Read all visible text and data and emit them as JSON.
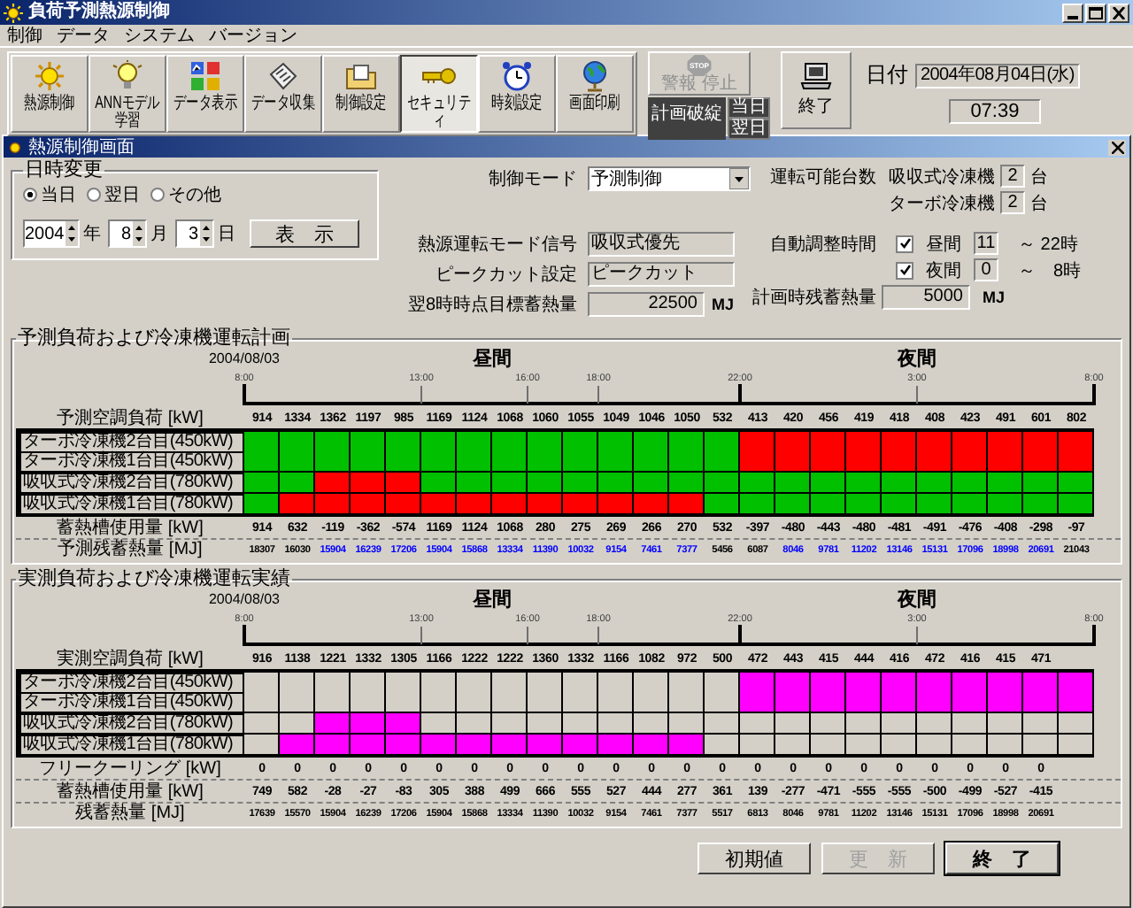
{
  "window": {
    "title": "負荷予測熱源制御"
  },
  "menu": [
    "制御",
    "データ",
    "システム",
    "バージョン"
  ],
  "toolbar": [
    {
      "label": "熱源制御",
      "kind": "sun",
      "selected": false
    },
    {
      "label": "ANNモデル学習",
      "kind": "bulb",
      "selected": false
    },
    {
      "label": "データ表示",
      "kind": "charts",
      "selected": false
    },
    {
      "label": "データ収集",
      "kind": "papers",
      "selected": false
    },
    {
      "label": "制御設定",
      "kind": "folder",
      "selected": false
    },
    {
      "label": "セキュリティ",
      "kind": "key",
      "selected": true
    },
    {
      "label": "時刻設定",
      "kind": "clock",
      "selected": false
    },
    {
      "label": "画面印刷",
      "kind": "globe",
      "selected": false
    }
  ],
  "alarm": {
    "sign": "STOP",
    "label": "警報 停止",
    "disabled": true
  },
  "plan_status": {
    "label": "計画破綻",
    "days": [
      "当日",
      "翌日"
    ]
  },
  "exit_button": "終了",
  "date": {
    "label": "日付",
    "value": "2004年08月04日(水)",
    "time": "07:39"
  },
  "screen": {
    "title": "熱源制御画面",
    "date_change": {
      "title": "日時変更",
      "options": [
        {
          "label": "当日",
          "selected": true
        },
        {
          "label": "翌日",
          "selected": false
        },
        {
          "label": "その他",
          "selected": false
        }
      ],
      "fields": [
        {
          "value": "2004",
          "unit": "年"
        },
        {
          "value": "8",
          "unit": "月"
        },
        {
          "value": "3",
          "unit": "日"
        }
      ],
      "button": "表　示"
    },
    "control_mode": {
      "label": "制御モード",
      "value": "予測制御"
    },
    "settings": [
      {
        "label": "熱源運転モード信号",
        "value": "吸収式優先"
      },
      {
        "label": "ピークカット設定",
        "value": "ピークカット"
      },
      {
        "label": "翌8時時点目標蓄熱量",
        "value": "22500",
        "unit": "MJ"
      }
    ],
    "available": {
      "label": "運転可能台数",
      "items": [
        {
          "name": "吸収式冷凍機",
          "value": "2",
          "unit": "台"
        },
        {
          "name": "ターボ冷凍機",
          "value": "2",
          "unit": "台"
        }
      ]
    },
    "auto_adjust": {
      "label": "自動調整時間",
      "items": [
        {
          "name": "昼間",
          "checked": true,
          "from": "11",
          "to": "～ 22時"
        },
        {
          "name": "夜間",
          "checked": true,
          "from": "0",
          "to": "～　8時"
        }
      ]
    },
    "plan_remaining": {
      "label": "計画時残蓄熱量",
      "value": "5000",
      "unit": "MJ"
    },
    "sections": [
      {
        "kind": "plan",
        "title": "予測負荷および冷凍機運転計画",
        "date": "2004/08/03",
        "periods": [
          "昼間",
          "夜間"
        ],
        "boundaries": [
          {
            "kind": "edge",
            "label": "8:00"
          },
          {
            "kind": "none"
          },
          {
            "kind": "none"
          },
          {
            "kind": "none"
          },
          {
            "kind": "none"
          },
          {
            "kind": "tick",
            "label": "13:00"
          },
          {
            "kind": "none"
          },
          {
            "kind": "none"
          },
          {
            "kind": "tick",
            "label": "16:00"
          },
          {
            "kind": "none"
          },
          {
            "kind": "tick",
            "label": "18:00"
          },
          {
            "kind": "none"
          },
          {
            "kind": "none"
          },
          {
            "kind": "none"
          },
          {
            "kind": "edge",
            "label": "22:00"
          },
          {
            "kind": "none"
          },
          {
            "kind": "none"
          },
          {
            "kind": "none"
          },
          {
            "kind": "none"
          },
          {
            "kind": "tick",
            "label": "3:00"
          },
          {
            "kind": "none"
          },
          {
            "kind": "none"
          },
          {
            "kind": "none"
          },
          {
            "kind": "none"
          },
          {
            "kind": "edge",
            "label": "8:00"
          }
        ],
        "rows": [
          {
            "kind": "load",
            "label": "予測空調負荷 [kW]",
            "values": [
              "914",
              "1334",
              "1362",
              "1197",
              "985",
              "1169",
              "1124",
              "1068",
              "1060",
              "1055",
              "1049",
              "1046",
              "1050",
              "532",
              "413",
              "420",
              "456",
              "419",
              "418",
              "408",
              "423",
              "491",
              "601",
              "802"
            ]
          },
          {
            "kind": "units",
            "label": "ターボ冷凍機2台目(450kW)",
            "cells": [
              false,
              false,
              false,
              false,
              false,
              false,
              false,
              false,
              false,
              false,
              false,
              false,
              false,
              false,
              true,
              true,
              true,
              true,
              true,
              true,
              true,
              true,
              true,
              true
            ]
          },
          {
            "kind": "units",
            "label": "ターボ冷凍機1台目(450kW)",
            "cells": [
              false,
              false,
              false,
              false,
              false,
              false,
              false,
              false,
              false,
              false,
              false,
              false,
              false,
              false,
              true,
              true,
              true,
              true,
              true,
              true,
              true,
              true,
              true,
              true
            ]
          },
          {
            "kind": "units",
            "label": "吸収式冷凍機2台目(780kW)",
            "cells": [
              false,
              false,
              true,
              true,
              true,
              false,
              false,
              false,
              false,
              false,
              false,
              false,
              false,
              false,
              false,
              false,
              false,
              false,
              false,
              false,
              false,
              false,
              false,
              false
            ]
          },
          {
            "kind": "units",
            "label": "吸収式冷凍機1台目(780kW)",
            "cells": [
              false,
              true,
              true,
              true,
              true,
              true,
              true,
              true,
              true,
              true,
              true,
              true,
              true,
              false,
              false,
              false,
              false,
              false,
              false,
              false,
              false,
              false,
              false,
              false
            ]
          },
          {
            "kind": "load",
            "label": "蓄熱槽使用量 [kW]",
            "values": [
              "914",
              "632",
              "-119",
              "-362",
              "-574",
              "1169",
              "1124",
              "1068",
              "280",
              "275",
              "269",
              "266",
              "270",
              "532",
              "-397",
              "-480",
              "-443",
              "-480",
              "-481",
              "-491",
              "-476",
              "-408",
              "-298",
              "-97"
            ]
          },
          {
            "kind": "amounts",
            "label": "予測残蓄熱量 [MJ]",
            "values": [
              {
                "text": "18307",
                "color": "#000000"
              },
              {
                "text": "16030",
                "color": "#000000"
              },
              {
                "text": "15904",
                "color": "#0000ff"
              },
              {
                "text": "16239",
                "color": "#0000ff"
              },
              {
                "text": "17206",
                "color": "#0000ff"
              },
              {
                "text": "15904",
                "color": "#0000ff"
              },
              {
                "text": "15868",
                "color": "#0000ff"
              },
              {
                "text": "13334",
                "color": "#0000ff"
              },
              {
                "text": "11390",
                "color": "#0000ff"
              },
              {
                "text": "10032",
                "color": "#0000ff"
              },
              {
                "text": "9154",
                "color": "#0000ff"
              },
              {
                "text": "7461",
                "color": "#0000ff"
              },
              {
                "text": "7377",
                "color": "#0000ff"
              },
              {
                "text": "5456",
                "color": "#000000"
              },
              {
                "text": "6087",
                "color": "#000000"
              },
              {
                "text": "8046",
                "color": "#0000ff"
              },
              {
                "text": "9781",
                "color": "#0000ff"
              },
              {
                "text": "11202",
                "color": "#0000ff"
              },
              {
                "text": "13146",
                "color": "#0000ff"
              },
              {
                "text": "15131",
                "color": "#0000ff"
              },
              {
                "text": "17096",
                "color": "#0000ff"
              },
              {
                "text": "18998",
                "color": "#0000ff"
              },
              {
                "text": "20691",
                "color": "#0000ff"
              },
              {
                "text": "21043",
                "color": "#000000"
              }
            ]
          }
        ]
      },
      {
        "kind": "actual",
        "title": "実測負荷および冷凍機運転実績",
        "date": "2004/08/03",
        "periods": [
          "昼間",
          "夜間"
        ],
        "boundaries": [
          {
            "kind": "edge",
            "label": "8:00"
          },
          {
            "kind": "none"
          },
          {
            "kind": "none"
          },
          {
            "kind": "none"
          },
          {
            "kind": "none"
          },
          {
            "kind": "tick",
            "label": "13:00"
          },
          {
            "kind": "none"
          },
          {
            "kind": "none"
          },
          {
            "kind": "tick",
            "label": "16:00"
          },
          {
            "kind": "none"
          },
          {
            "kind": "tick",
            "label": "18:00"
          },
          {
            "kind": "none"
          },
          {
            "kind": "none"
          },
          {
            "kind": "none"
          },
          {
            "kind": "edge",
            "label": "22:00"
          },
          {
            "kind": "none"
          },
          {
            "kind": "none"
          },
          {
            "kind": "none"
          },
          {
            "kind": "none"
          },
          {
            "kind": "tick",
            "label": "3:00"
          },
          {
            "kind": "none"
          },
          {
            "kind": "none"
          },
          {
            "kind": "none"
          },
          {
            "kind": "none"
          },
          {
            "kind": "edge",
            "label": "8:00"
          }
        ],
        "rows": [
          {
            "kind": "load",
            "label": "実測空調負荷 [kW]",
            "values": [
              "916",
              "1138",
              "1221",
              "1332",
              "1305",
              "1166",
              "1222",
              "1222",
              "1360",
              "1332",
              "1166",
              "1082",
              "972",
              "500",
              "472",
              "443",
              "415",
              "444",
              "416",
              "472",
              "416",
              "415",
              "471"
            ]
          },
          {
            "kind": "units",
            "label": "ターボ冷凍機2台目(450kW)",
            "cells": [
              false,
              false,
              false,
              false,
              false,
              false,
              false,
              false,
              false,
              false,
              false,
              false,
              false,
              false,
              true,
              true,
              true,
              true,
              true,
              true,
              true,
              true,
              true,
              true
            ]
          },
          {
            "kind": "units",
            "label": "ターボ冷凍機1台目(450kW)",
            "cells": [
              false,
              false,
              false,
              false,
              false,
              false,
              false,
              false,
              false,
              false,
              false,
              false,
              false,
              false,
              true,
              true,
              true,
              true,
              true,
              true,
              true,
              true,
              true,
              true
            ]
          },
          {
            "kind": "units",
            "label": "吸収式冷凍機2台目(780kW)",
            "cells": [
              false,
              false,
              true,
              true,
              true,
              false,
              false,
              false,
              false,
              false,
              false,
              false,
              false,
              false,
              false,
              false,
              false,
              false,
              false,
              false,
              false,
              false,
              false,
              false
            ]
          },
          {
            "kind": "units",
            "label": "吸収式冷凍機1台目(780kW)",
            "cells": [
              false,
              true,
              true,
              true,
              true,
              true,
              true,
              true,
              true,
              true,
              true,
              true,
              true,
              false,
              false,
              false,
              false,
              false,
              false,
              false,
              false,
              false,
              false,
              false
            ]
          },
          {
            "kind": "load",
            "label": "フリークーリング [kW]",
            "values": [
              "0",
              "0",
              "0",
              "0",
              "0",
              "0",
              "0",
              "0",
              "0",
              "0",
              "0",
              "0",
              "0",
              "0",
              "0",
              "0",
              "0",
              "0",
              "0",
              "0",
              "0",
              "0",
              "0"
            ]
          },
          {
            "kind": "load",
            "label": "蓄熱槽使用量 [kW]",
            "values": [
              "749",
              "582",
              "-28",
              "-27",
              "-83",
              "305",
              "388",
              "499",
              "666",
              "555",
              "527",
              "444",
              "277",
              "361",
              "139",
              "-277",
              "-471",
              "-555",
              "-555",
              "-500",
              "-499",
              "-527",
              "-415"
            ]
          },
          {
            "kind": "amounts",
            "label": "残蓄熱量 [MJ]",
            "values": [
              {
                "text": "17639",
                "color": "#000000"
              },
              {
                "text": "15570",
                "color": "#000000"
              },
              {
                "text": "15904",
                "color": "#000000"
              },
              {
                "text": "16239",
                "color": "#000000"
              },
              {
                "text": "17206",
                "color": "#000000"
              },
              {
                "text": "15904",
                "color": "#000000"
              },
              {
                "text": "15868",
                "color": "#000000"
              },
              {
                "text": "13334",
                "color": "#000000"
              },
              {
                "text": "11390",
                "color": "#000000"
              },
              {
                "text": "10032",
                "color": "#000000"
              },
              {
                "text": "9154",
                "color": "#000000"
              },
              {
                "text": "7461",
                "color": "#000000"
              },
              {
                "text": "7377",
                "color": "#000000"
              },
              {
                "text": "5517",
                "color": "#000000"
              },
              {
                "text": "6813",
                "color": "#000000"
              },
              {
                "text": "8046",
                "color": "#000000"
              },
              {
                "text": "9781",
                "color": "#000000"
              },
              {
                "text": "11202",
                "color": "#000000"
              },
              {
                "text": "13146",
                "color": "#000000"
              },
              {
                "text": "15131",
                "color": "#000000"
              },
              {
                "text": "17096",
                "color": "#000000"
              },
              {
                "text": "18998",
                "color": "#000000"
              },
              {
                "text": "20691",
                "color": "#000000"
              }
            ]
          }
        ]
      }
    ],
    "buttons": [
      {
        "label": "初期値",
        "disabled": false,
        "default": false
      },
      {
        "label": "更　新",
        "disabled": true,
        "default": false
      },
      {
        "label": "終　了",
        "disabled": false,
        "default": true
      }
    ]
  }
}
